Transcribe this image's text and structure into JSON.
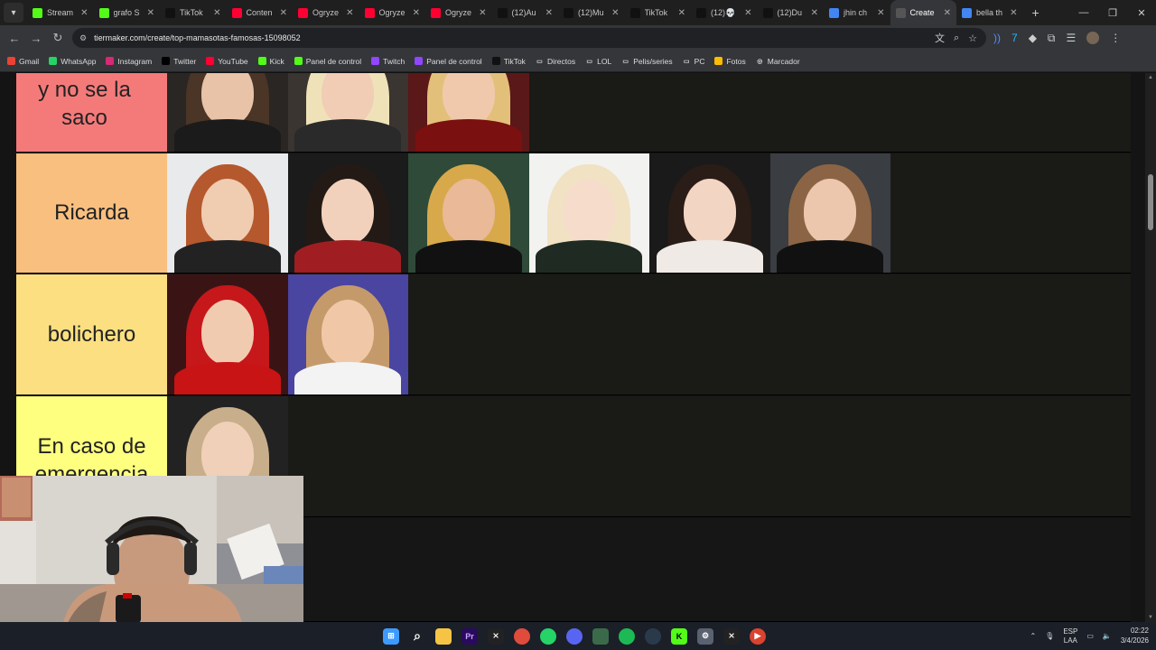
{
  "browser": {
    "tabs": [
      {
        "label": "Stream",
        "icon": "kick-icon",
        "color": "#53fc18"
      },
      {
        "label": "grafo S",
        "icon": "kick-icon",
        "color": "#53fc18"
      },
      {
        "label": "TikTok",
        "icon": "tiktok-icon",
        "color": "#111111"
      },
      {
        "label": "Conten",
        "icon": "youtube-icon",
        "color": "#ff0033"
      },
      {
        "label": "Ogryze",
        "icon": "youtube-icon",
        "color": "#ff0033"
      },
      {
        "label": "Ogryze",
        "icon": "youtube-icon",
        "color": "#ff0033"
      },
      {
        "label": "Ogryze",
        "icon": "youtube-icon",
        "color": "#ff0033"
      },
      {
        "label": "(12)Au",
        "icon": "tiktok-icon",
        "color": "#111111"
      },
      {
        "label": "(12)Mu",
        "icon": "tiktok-icon",
        "color": "#111111"
      },
      {
        "label": "TikTok",
        "icon": "tiktok-icon",
        "color": "#111111"
      },
      {
        "label": "(12)💀",
        "icon": "tiktok-icon",
        "color": "#111111"
      },
      {
        "label": "(12)Du",
        "icon": "tiktok-icon",
        "color": "#111111"
      },
      {
        "label": "jhin ch",
        "icon": "google-icon",
        "color": "#4285f4"
      },
      {
        "label": "Create",
        "icon": "tiermaker-icon",
        "color": "#555555",
        "active": true
      },
      {
        "label": "bella th",
        "icon": "google-icon",
        "color": "#4285f4"
      }
    ],
    "url": "tiermaker.com/create/top-mamasotas-famosas-15098052",
    "bookmarks": [
      {
        "label": "Gmail",
        "icon": "gmail-icon",
        "color": "#ea4335"
      },
      {
        "label": "WhatsApp",
        "icon": "whatsapp-icon",
        "color": "#25d366"
      },
      {
        "label": "Instagram",
        "icon": "instagram-icon",
        "color": "#d62976"
      },
      {
        "label": "Twitter",
        "icon": "x-icon",
        "color": "#000000"
      },
      {
        "label": "YouTube",
        "icon": "youtube-icon",
        "color": "#ff0033"
      },
      {
        "label": "Kick",
        "icon": "kick-icon",
        "color": "#53fc18"
      },
      {
        "label": "Panel de control",
        "icon": "kick-icon",
        "color": "#53fc18"
      },
      {
        "label": "Twitch",
        "icon": "twitch-icon",
        "color": "#9146ff"
      },
      {
        "label": "Panel de control",
        "icon": "twitch-icon",
        "color": "#9146ff"
      },
      {
        "label": "TikTok",
        "icon": "tiktok-icon",
        "color": "#111111"
      },
      {
        "label": "Directos",
        "icon": "folder-icon",
        "color": "#35363a"
      },
      {
        "label": "LOL",
        "icon": "folder-icon",
        "color": "#35363a"
      },
      {
        "label": "Pelis/series",
        "icon": "folder-icon",
        "color": "#35363a"
      },
      {
        "label": "PC",
        "icon": "folder-icon",
        "color": "#35363a"
      },
      {
        "label": "Fotos",
        "icon": "photos-icon",
        "color": "#fbbc04"
      },
      {
        "label": "Marcador",
        "icon": "globe-icon",
        "color": "#35363a"
      }
    ]
  },
  "tierlist": {
    "rows": [
      {
        "label": "y no se la saco",
        "color": "#f47a7a",
        "pics": 3
      },
      {
        "label": "Ricarda",
        "color": "#f9bf7f",
        "pics": 6
      },
      {
        "label": "bolichero",
        "color": "#fbdf80",
        "pics": 2
      },
      {
        "label": "En caso de emergencia",
        "color": "#ffff7f",
        "pics": 1
      }
    ]
  },
  "taskbar": {
    "lang": "ESP",
    "lang2": "LAA",
    "time": "02:22",
    "date": "3/4/2026"
  }
}
